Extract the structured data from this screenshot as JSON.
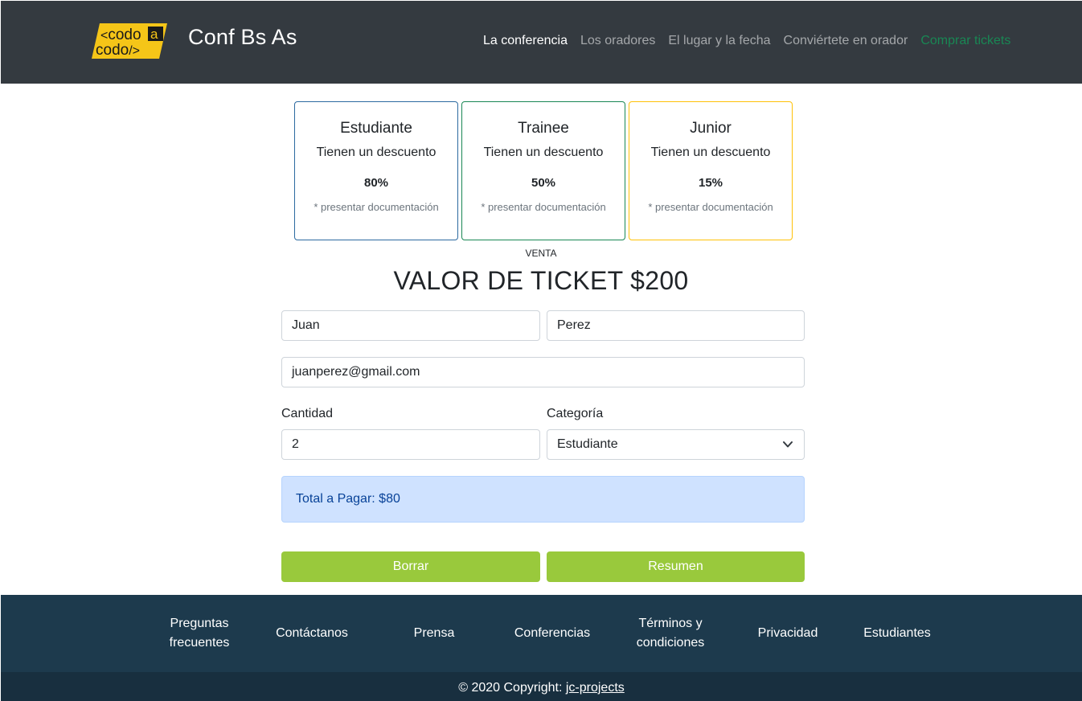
{
  "navbar": {
    "logo_top": "<codo a",
    "logo_bottom": "codo/>",
    "logo_color": "#f5c518",
    "brand": "Conf Bs As",
    "links": [
      {
        "label": "La conferencia",
        "state": "active"
      },
      {
        "label": "Los oradores",
        "state": "normal"
      },
      {
        "label": "El lugar y la fecha",
        "state": "normal"
      },
      {
        "label": "Conviértete en orador",
        "state": "normal"
      },
      {
        "label": "Comprar tickets",
        "state": "success"
      }
    ]
  },
  "cards": [
    {
      "title": "Estudiante",
      "text": "Tienen un descuento",
      "discount": "80%",
      "note": "* presentar documentación",
      "border_color": "#2c6aa0"
    },
    {
      "title": "Trainee",
      "text": "Tienen un descuento",
      "discount": "50%",
      "note": "* presentar documentación",
      "border_color": "#198754"
    },
    {
      "title": "Junior",
      "text": "Tienen un descuento",
      "discount": "15%",
      "note": "* presentar documentación",
      "border_color": "#ffc107"
    }
  ],
  "sale": {
    "label": "VENTA",
    "title": "VALOR DE TICKET $200"
  },
  "form": {
    "first_name": "Juan",
    "last_name": "Perez",
    "email": "juanperez@gmail.com",
    "quantity_label": "Cantidad",
    "quantity": "2",
    "category_label": "Categoría",
    "category": "Estudiante",
    "total": "Total a Pagar: $80",
    "clear_button": "Borrar",
    "summary_button": "Resumen",
    "button_color": "#99c93c"
  },
  "footer": {
    "items": [
      {
        "line1": "Preguntas",
        "line2": "frecuentes"
      },
      {
        "line1": "Contáctanos",
        "line2": ""
      },
      {
        "line1": "Prensa",
        "line2": ""
      },
      {
        "line1": "Conferencias",
        "line2": ""
      },
      {
        "line1": "Términos y",
        "line2": "condiciones"
      },
      {
        "line1": "Privacidad",
        "line2": ""
      },
      {
        "line1": "Estudiantes",
        "line2": ""
      }
    ],
    "copyright_prefix": "© 2020 Copyright: ",
    "copyright_link": "jc-projects"
  }
}
